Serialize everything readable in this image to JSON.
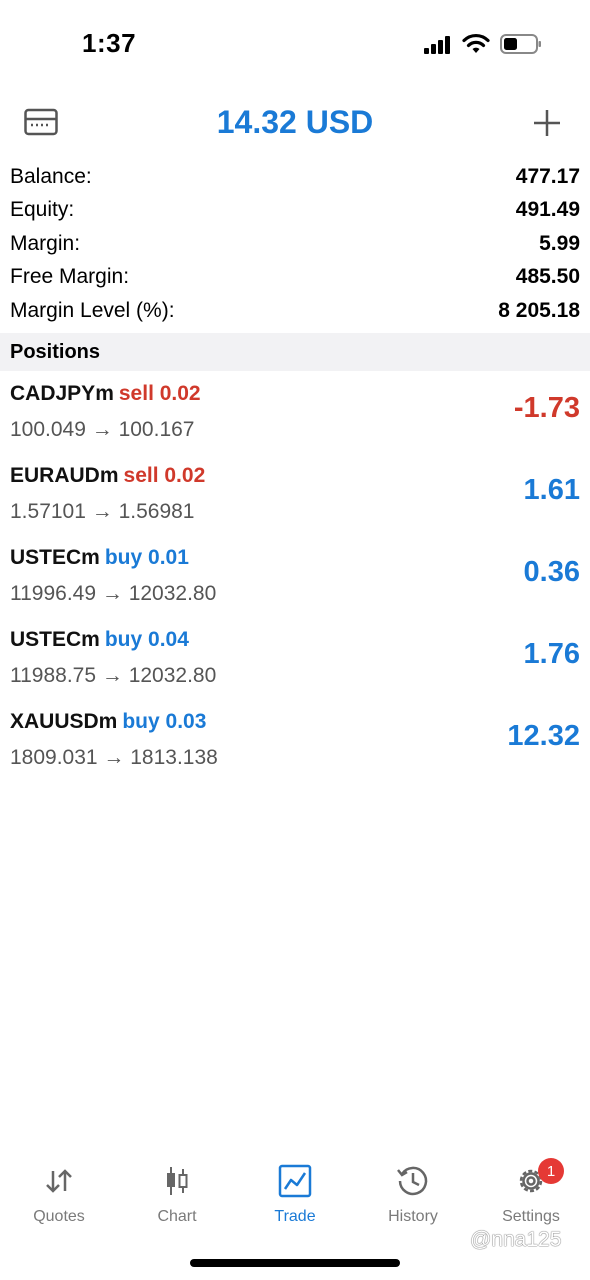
{
  "status_bar": {
    "time": "1:37"
  },
  "header": {
    "balance_title": "14.32 USD"
  },
  "summary": [
    {
      "label": "Balance:",
      "value": "477.17"
    },
    {
      "label": "Equity:",
      "value": "491.49"
    },
    {
      "label": "Margin:",
      "value": "5.99"
    },
    {
      "label": "Free Margin:",
      "value": "485.50"
    },
    {
      "label": "Margin Level (%):",
      "value": "8 205.18"
    }
  ],
  "positions_header": "Positions",
  "positions": [
    {
      "symbol": "CADJPYm",
      "type": "sell 0.02",
      "prices": "100.049 → 100.167",
      "profit": "-1.73"
    },
    {
      "symbol": "EURAUDm",
      "type": "sell 0.02",
      "prices": "1.57101 → 1.56981",
      "profit": "1.61"
    },
    {
      "symbol": "USTECm",
      "type": "buy 0.01",
      "prices": "11996.49 → 12032.80",
      "profit": "0.36"
    },
    {
      "symbol": "USTECm",
      "type": "buy 0.04",
      "prices": "11988.75 → 12032.80",
      "profit": "1.76"
    },
    {
      "symbol": "XAUUSDm",
      "type": "buy 0.03",
      "prices": "1809.031 → 1813.138",
      "profit": "12.32"
    }
  ],
  "tabs": [
    {
      "label": "Quotes",
      "icon": "quotes-arrows-icon"
    },
    {
      "label": "Chart",
      "icon": "candlestick-icon"
    },
    {
      "label": "Trade",
      "icon": "trade-chart-icon",
      "active": true
    },
    {
      "label": "History",
      "icon": "history-clock-icon"
    },
    {
      "label": "Settings",
      "icon": "gear-icon",
      "badge": "1"
    }
  ],
  "watermark": "@nna125",
  "colors": {
    "accent": "#1a7ad6",
    "negative": "#d0392b",
    "badge": "#e53935"
  }
}
